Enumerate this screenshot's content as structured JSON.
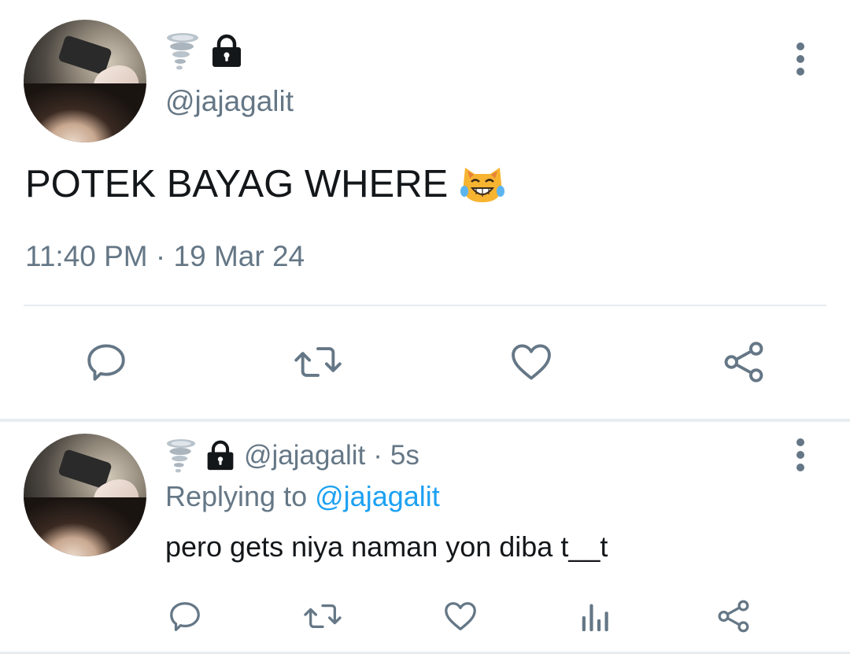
{
  "main_tweet": {
    "handle": "@jajagalit",
    "text": "POTEK BAYAG WHERE",
    "emoji": "cat-with-tears-of-joy",
    "timestamp": "11:40 PM · 19 Mar 24",
    "icons": [
      "tornado-icon",
      "lock-icon"
    ]
  },
  "reply_tweet": {
    "handle": "@jajagalit",
    "separator": "·",
    "age": "5s",
    "replying_prefix": "Replying to",
    "replying_mention": "@jajagalit",
    "text": "pero gets niya naman yon diba t__t",
    "icons": [
      "tornado-icon",
      "lock-icon"
    ]
  },
  "actions": {
    "main": [
      "reply-icon",
      "retweet-icon",
      "like-icon",
      "share-icon"
    ],
    "reply": [
      "reply-icon",
      "retweet-icon",
      "like-icon",
      "stats-icon",
      "share-icon"
    ]
  },
  "colors": {
    "text": "#14171a",
    "muted": "#657786",
    "link": "#1da1f2",
    "divider": "#e6ecf0"
  }
}
